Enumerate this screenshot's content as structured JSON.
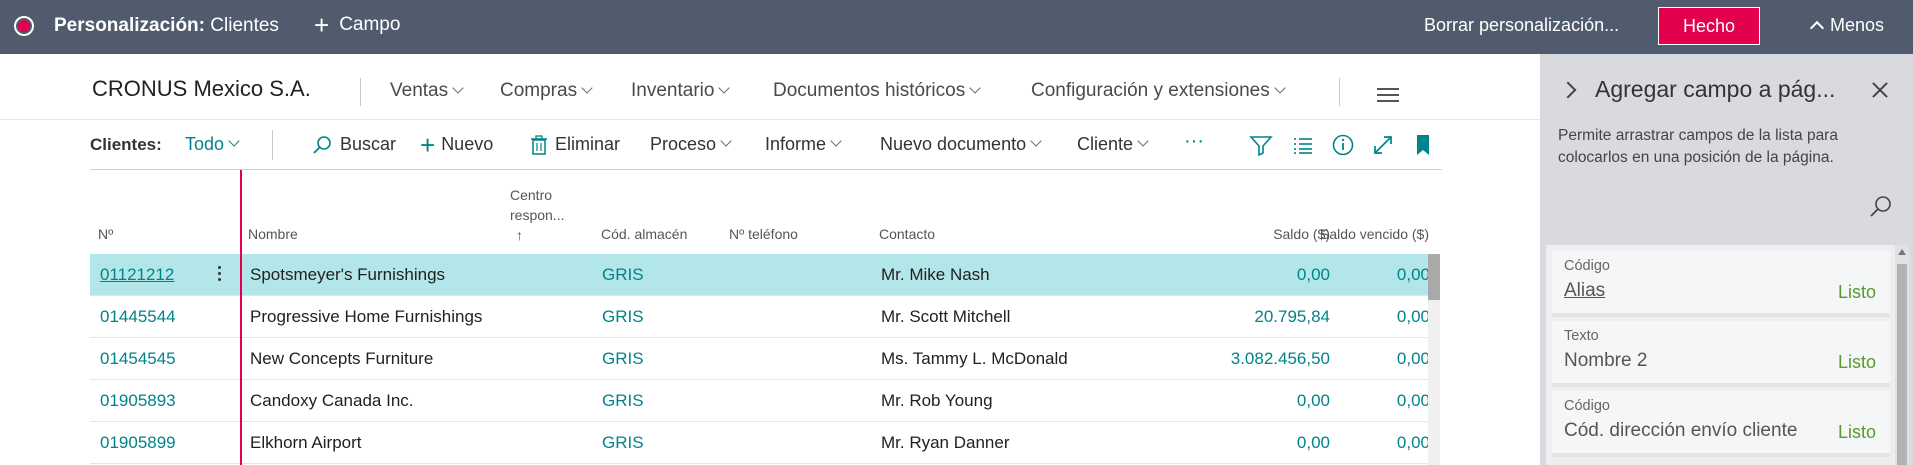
{
  "topbar": {
    "title_bold": "Personalización:",
    "title_rest": " Clientes",
    "campo_label": "Campo",
    "borrar_label": "Borrar personalización...",
    "hecho_label": "Hecho",
    "menos_label": "Menos",
    "bg_color": "#505c6d",
    "accent_color": "#e3004f"
  },
  "nav": {
    "company": "CRONUS Mexico S.A.",
    "items": [
      {
        "label": "Ventas"
      },
      {
        "label": "Compras"
      },
      {
        "label": "Inventario"
      },
      {
        "label": "Documentos históricos"
      },
      {
        "label": "Configuración y extensiones"
      }
    ]
  },
  "actions": {
    "list_label": "Clientes:",
    "filter_value": "Todo",
    "buscar": "Buscar",
    "nuevo": "Nuevo",
    "eliminar": "Eliminar",
    "proceso": "Proceso",
    "informe": "Informe",
    "nuevo_documento": "Nuevo documento",
    "cliente": "Cliente",
    "more": "···"
  },
  "grid": {
    "columns": {
      "no": "Nº",
      "nombre": "Nombre",
      "centro_line1": "Centro",
      "centro_line2": "respon...",
      "centro_sort": "↑",
      "almacen": "Cód. almacén",
      "telefono": "Nº teléfono",
      "contacto": "Contacto",
      "saldo": "Saldo ($)",
      "saldo_vencido": "Saldo vencido ($)"
    },
    "rows": [
      {
        "no": "01121212",
        "nombre": "Spotsmeyer's Furnishings",
        "almacen": "GRIS",
        "contacto": "Mr. Mike Nash",
        "saldo": "0,00",
        "vencido": "0,00"
      },
      {
        "no": "01445544",
        "nombre": "Progressive Home Furnishings",
        "almacen": "GRIS",
        "contacto": "Mr. Scott Mitchell",
        "saldo": "20.795,84",
        "vencido": "0,00"
      },
      {
        "no": "01454545",
        "nombre": "New Concepts Furniture",
        "almacen": "GRIS",
        "contacto": "Ms. Tammy L. McDonald",
        "saldo": "3.082.456,50",
        "vencido": "0,00"
      },
      {
        "no": "01905893",
        "nombre": "Candoxy Canada Inc.",
        "almacen": "GRIS",
        "contacto": "Mr. Rob Young",
        "saldo": "0,00",
        "vencido": "0,00"
      },
      {
        "no": "01905899",
        "nombre": "Elkhorn Airport",
        "almacen": "GRIS",
        "contacto": "Mr. Ryan Danner",
        "saldo": "0,00",
        "vencido": "0,00"
      }
    ],
    "selected_row_color": "#b3e6e9",
    "link_color": "#008489"
  },
  "panel": {
    "title": "Agregar campo a pág...",
    "description": "Permite arrastrar campos de la lista para colocarlos en una posición de la página.",
    "fields": [
      {
        "type": "Código",
        "name": "Alias",
        "status": "Listo"
      },
      {
        "type": "Texto",
        "name": "Nombre 2",
        "status": "Listo"
      },
      {
        "type": "Código",
        "name": "Cód. dirección envío cliente",
        "status": "Listo"
      }
    ],
    "status_color": "#5a9a2c"
  }
}
